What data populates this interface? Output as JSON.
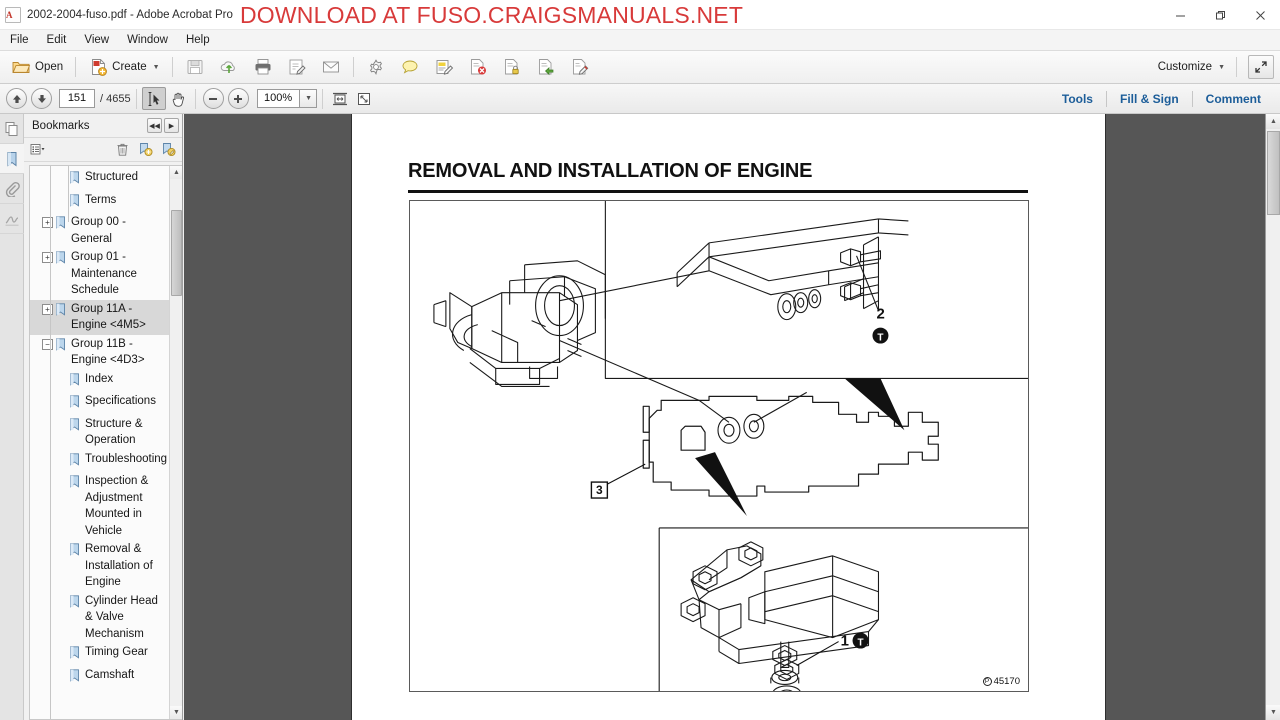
{
  "window": {
    "title": "2002-2004-fuso.pdf - Adobe Acrobat Pro",
    "overlay_banner": "DOWNLOAD AT FUSO.CRAIGSMANUALS.NET",
    "banner_color": "#d83a3a",
    "minimize": "—",
    "restore": "❐",
    "close": "✕"
  },
  "menubar": {
    "items": [
      "File",
      "Edit",
      "View",
      "Window",
      "Help"
    ]
  },
  "toolbar": {
    "open_label": "Open",
    "create_label": "Create",
    "customize_label": "Customize",
    "icons": [
      "open-folder-icon",
      "create-icon",
      "save-icon",
      "upload-cloud-icon",
      "print-icon",
      "sign-icon",
      "email-icon",
      "settings-gear-icon",
      "sticky-note-icon",
      "highlight-text-icon",
      "redact-icon",
      "protect-icon",
      "export-icon",
      "edit-pdf-icon"
    ],
    "expand_icon": "expand-icon"
  },
  "navbar": {
    "page_current": "151",
    "page_total": "/ 4655",
    "zoom_level": "100%",
    "select_tool_icon": "select-tool-icon",
    "hand_tool_icon": "hand-tool-icon",
    "zoom_out_icon": "minus-icon",
    "zoom_in_icon": "plus-icon",
    "fit_width_icon": "fit-width-icon",
    "fit_page_icon": "fit-page-icon",
    "prev_page_icon": "arrow-up-icon",
    "next_page_icon": "arrow-down-icon",
    "tabs": [
      "Tools",
      "Fill & Sign",
      "Comment"
    ]
  },
  "rail": {
    "items": [
      {
        "name": "page-thumbnails",
        "icon": "page-thumbnails-icon",
        "active": false
      },
      {
        "name": "bookmarks",
        "icon": "bookmark-icon",
        "active": true
      },
      {
        "name": "attachments",
        "icon": "paperclip-icon",
        "active": false
      },
      {
        "name": "signatures",
        "icon": "signature-icon",
        "active": false
      }
    ]
  },
  "bookmarks_panel": {
    "title": "Bookmarks",
    "collapse_icon": "◀◀",
    "expand_icon": "▶",
    "options_icon": "options-list-icon",
    "delete_icon": "trash-icon",
    "new_bookmark_icon": "new-bookmark-icon",
    "edit_bookmark_icon": "edit-bookmark-icon",
    "scroll_up": "▲",
    "scroll_down": "▼",
    "items": [
      {
        "label": "Structured",
        "depth": 2,
        "toggle": null,
        "selected": false
      },
      {
        "label": "Terms",
        "depth": 2,
        "toggle": null,
        "selected": false
      },
      {
        "label": "Group 00 - General",
        "depth": 1,
        "toggle": "+",
        "selected": false
      },
      {
        "label": "Group 01 - Maintenance Schedule",
        "depth": 1,
        "toggle": "+",
        "selected": false
      },
      {
        "label": "Group 11A - Engine <4M5>",
        "depth": 1,
        "toggle": "+",
        "selected": true
      },
      {
        "label": "Group 11B - Engine <4D3>",
        "depth": 1,
        "toggle": "−",
        "selected": false
      },
      {
        "label": "Index",
        "depth": 2,
        "toggle": null,
        "selected": false
      },
      {
        "label": "Specifications",
        "depth": 2,
        "toggle": null,
        "selected": false
      },
      {
        "label": "Structure & Operation",
        "depth": 2,
        "toggle": null,
        "selected": false
      },
      {
        "label": "Troubleshooting",
        "depth": 2,
        "toggle": null,
        "selected": false
      },
      {
        "label": "Inspection & Adjustment Mounted in Vehicle",
        "depth": 2,
        "toggle": null,
        "selected": false
      },
      {
        "label": "Removal & Installation of Engine",
        "depth": 2,
        "toggle": null,
        "selected": false
      },
      {
        "label": "Cylinder Head & Valve Mechanism",
        "depth": 2,
        "toggle": null,
        "selected": false
      },
      {
        "label": "Timing Gear",
        "depth": 2,
        "toggle": null,
        "selected": false
      },
      {
        "label": "Camshaft",
        "depth": 2,
        "toggle": null,
        "selected": false
      }
    ]
  },
  "document": {
    "heading": "REMOVAL AND INSTALLATION OF ENGINE",
    "figure_id": "45170",
    "figure_id_prefix": "P",
    "callouts": [
      {
        "number": "2",
        "marker": "T"
      },
      {
        "number": "3",
        "marker": null
      },
      {
        "number": "1",
        "marker": "T"
      }
    ]
  }
}
